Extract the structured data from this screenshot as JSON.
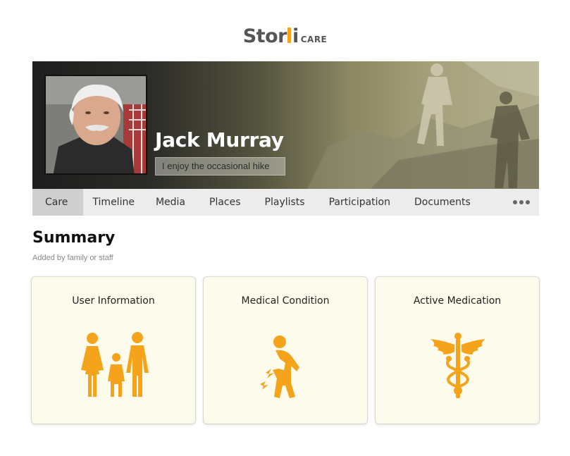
{
  "brand": {
    "word_start": "Stor",
    "word_end": "i",
    "suffix": "CARE",
    "accent": "#f5a31a"
  },
  "profile": {
    "name": "Jack Murray",
    "tagline": "I enjoy the occasional hike"
  },
  "tabs": [
    {
      "label": "Care",
      "active": true
    },
    {
      "label": "Timeline"
    },
    {
      "label": "Media"
    },
    {
      "label": "Places"
    },
    {
      "label": "Playlists"
    },
    {
      "label": "Participation"
    },
    {
      "label": "Documents"
    }
  ],
  "summary": {
    "title": "Summary",
    "subtitle": "Added by family or staff"
  },
  "cards": [
    {
      "label": "User Information",
      "icon": "family-icon"
    },
    {
      "label": "Medical Condition",
      "icon": "stomach-pain-icon"
    },
    {
      "label": "Active Medication",
      "icon": "caduceus-icon"
    }
  ],
  "colors": {
    "icon": "#f5a31a",
    "card_bg": "#fdfcec",
    "tab_bar": "#ececec",
    "tab_active": "#cfcfcf"
  }
}
